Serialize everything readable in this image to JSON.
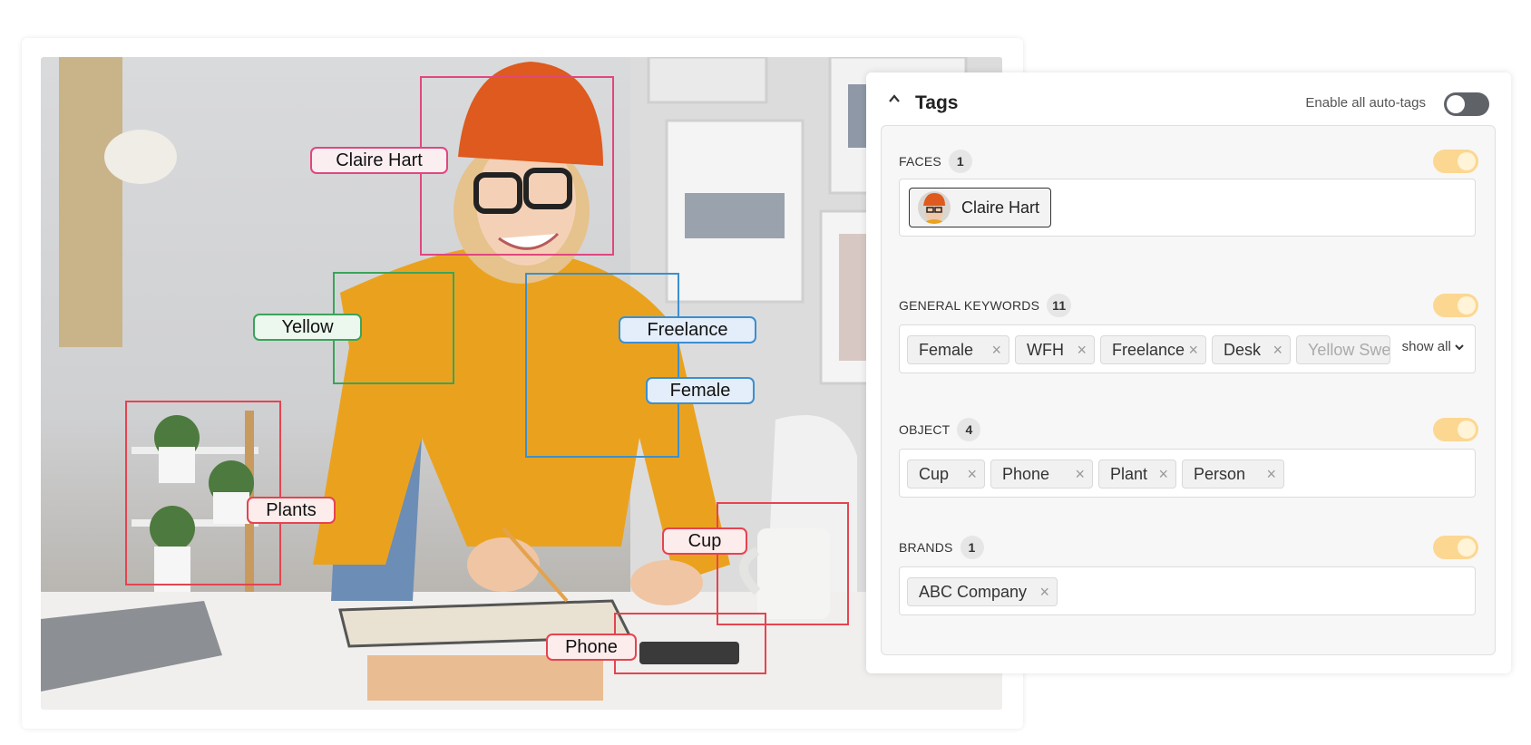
{
  "photo": {
    "labels": {
      "claire": "Claire Hart",
      "yellow": "Yellow",
      "freelance": "Freelance",
      "female": "Female",
      "plants": "Plants",
      "cup": "Cup",
      "phone": "Phone"
    }
  },
  "panel": {
    "title": "Tags",
    "auto_tags_label": "Enable all auto-tags",
    "sections": {
      "faces": {
        "label": "FACES",
        "count": "1",
        "person": "Claire Hart"
      },
      "keywords": {
        "label": "GENERAL KEYWORDS",
        "count": "11",
        "chips": [
          "Female",
          "WFH",
          "Freelance",
          "Desk",
          "Yellow Sweater"
        ],
        "show_all": "show all"
      },
      "object": {
        "label": "OBJECT",
        "count": "4",
        "chips": [
          "Cup",
          "Phone",
          "Plant",
          "Person"
        ]
      },
      "brands": {
        "label": "BRANDS",
        "count": "1",
        "chips": [
          "ABC Company"
        ]
      }
    }
  },
  "colors": {
    "face": "#e04780",
    "color_tag": "#3aa45a",
    "keyword": "#3b8fd0",
    "object": "#e54450",
    "toggle_on": "#fcd791"
  },
  "icons": {
    "collapse": "chevron-up-icon",
    "remove": "close-icon",
    "expand": "chevron-down-icon"
  }
}
